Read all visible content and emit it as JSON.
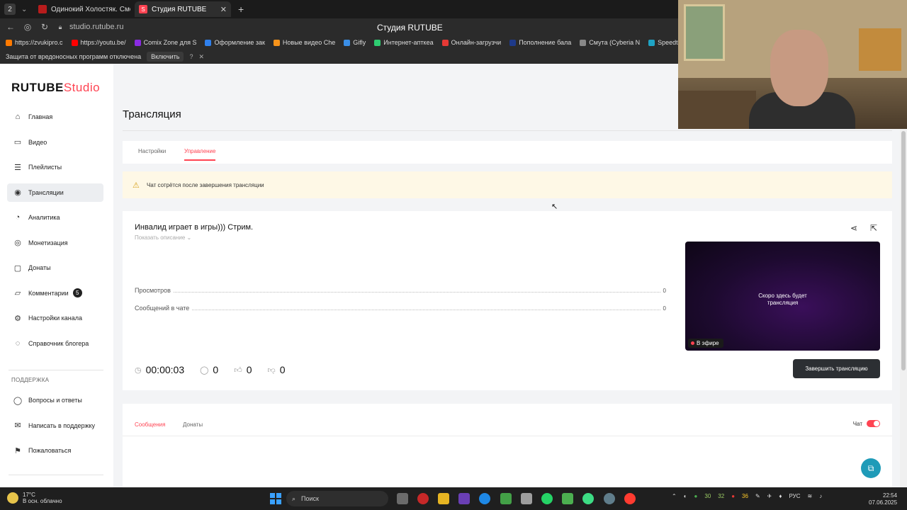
{
  "browser": {
    "tab_counter": "2",
    "tabs": [
      {
        "label": "Одинокий Холостяк. Смо",
        "icon_color": "#b71c1c"
      },
      {
        "label": "Студия RUTUBE",
        "icon_color": "#ff4352"
      }
    ],
    "url": "studio.rutube.ru",
    "page_title": "Студия RUTUBE",
    "bookmarks": [
      {
        "label": "https://zvukipro.c",
        "color": "#ff7a00"
      },
      {
        "label": "https://youtu.be/",
        "color": "#ff0000"
      },
      {
        "label": "Comix Zone для S",
        "color": "#8a2be2"
      },
      {
        "label": "Оформление зак",
        "color": "#2f80ed"
      },
      {
        "label": "Новые видео Che",
        "color": "#f7931a"
      },
      {
        "label": "Gifly",
        "color": "#3a8ee6"
      },
      {
        "label": "Интернет-апткеа",
        "color": "#2ecc71"
      },
      {
        "label": "Онлайн-загрузчи",
        "color": "#e53935"
      },
      {
        "label": "Пополнение бала",
        "color": "#1e3a8a"
      },
      {
        "label": "Смута (Cyberia N",
        "color": "#888888"
      },
      {
        "label": "Speedt",
        "color": "#1fa3c4"
      }
    ],
    "protection_text": "Защита от вредоносных программ отключена",
    "protection_button": "Включить"
  },
  "sidebar": {
    "logo_main": "RUTUBE",
    "logo_sub": "Studio",
    "items": [
      {
        "label": "Главная",
        "icon": "home-icon"
      },
      {
        "label": "Видео",
        "icon": "video-icon"
      },
      {
        "label": "Плейлисты",
        "icon": "playlist-icon"
      },
      {
        "label": "Трансляции",
        "icon": "broadcast-icon",
        "active": true
      },
      {
        "label": "Аналитика",
        "icon": "analytics-icon"
      },
      {
        "label": "Монетизация",
        "icon": "monetization-icon"
      },
      {
        "label": "Донаты",
        "icon": "donate-icon"
      },
      {
        "label": "Комментарии",
        "icon": "comments-icon",
        "badge": "5"
      },
      {
        "label": "Настройки канала",
        "icon": "settings-icon"
      },
      {
        "label": "Справочник блогера",
        "icon": "handbook-icon"
      }
    ],
    "support_heading": "ПОДДЕРЖКА",
    "support_items": [
      {
        "label": "Вопросы и ответы",
        "icon": "faq-icon"
      },
      {
        "label": "Написать в поддержку",
        "icon": "mail-icon"
      },
      {
        "label": "Пожаловаться",
        "icon": "flag-icon"
      }
    ]
  },
  "main": {
    "title": "Трансляция",
    "tabs": [
      "Настройки",
      "Управление"
    ],
    "active_tab": "Управление",
    "alert": "Чат сотрётся после завершения трансляции",
    "stream": {
      "title": "Инвалид играет в игры))) Стрим.",
      "show_description": "Показать описание",
      "stats": [
        {
          "label": "Просмотров",
          "value": "0"
        },
        {
          "label": "Сообщений в чате",
          "value": "0"
        }
      ],
      "timer": "00:00:03",
      "viewers": "0",
      "likes": "0",
      "dislikes": "0",
      "player_text_line1": "Скоро здесь будет",
      "player_text_line2": "трансляция",
      "live_label": "В эфире",
      "end_button": "Завершить трансляцию"
    },
    "chat": {
      "tabs": [
        "Сообщения",
        "Донаты"
      ],
      "active_tab": "Сообщения",
      "toggle_label": "Чат",
      "toggle_on": true
    },
    "accent_color": "#ff4352"
  },
  "taskbar": {
    "temperature": "17°C",
    "weather": "В осн. облачно",
    "search": "Поиск",
    "tray_numbers": [
      "30",
      "32",
      "36"
    ],
    "language": "РУС",
    "time": "22:54",
    "date": "07.06.2025"
  }
}
